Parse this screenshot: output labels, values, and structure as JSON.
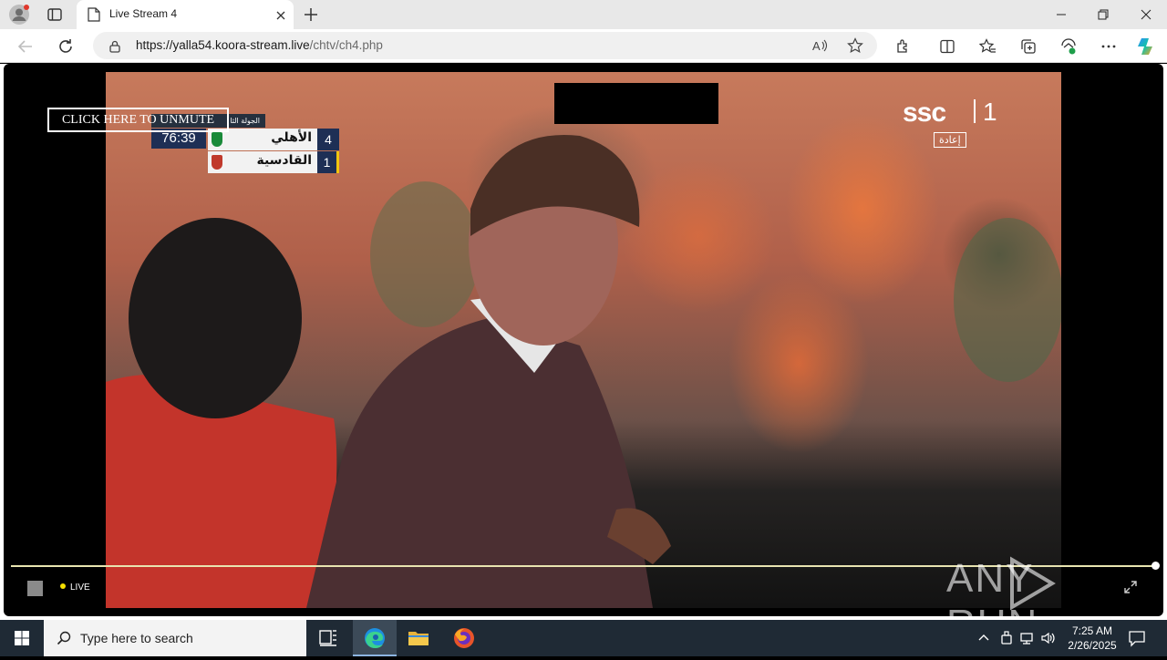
{
  "browser": {
    "tab_title": "Live Stream 4",
    "url_host": "https://yalla54.koora-stream.live",
    "url_path": "/chtv/ch4.php"
  },
  "player": {
    "unmute_label": "CLICK HERE TO UNMUTE",
    "live_label": "LIVE",
    "progress_fraction": 1.0,
    "watermark": "ANY RUN"
  },
  "broadcast": {
    "round_text": "الجولة الثا",
    "clock": "76:39",
    "channel_logo": "ssc",
    "channel_number": "1",
    "replay_label": "إعادة",
    "teams": [
      {
        "name": "الأهلي",
        "score": "4",
        "badge_color": "#1a8a3a"
      },
      {
        "name": "القادسية",
        "score": "1",
        "badge_color": "#c0392b"
      }
    ]
  },
  "taskbar": {
    "search_placeholder": "Type here to search",
    "time": "7:25 AM",
    "date": "2/26/2025"
  },
  "colors": {
    "taskbar_bg": "#1f2a35",
    "accent": "#0078d4",
    "live_dot": "#f5e000"
  }
}
